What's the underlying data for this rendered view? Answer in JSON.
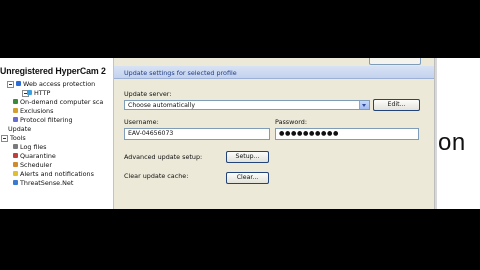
{
  "watermark": "Unregistered HyperCam 2",
  "tree": {
    "items": [
      {
        "label": "Web access protection",
        "icon_color": "#2a6bd8"
      },
      {
        "label": "HTTP",
        "icon_color": "#3aa0e0"
      },
      {
        "label": "On-demand computer sca",
        "icon_color": "#3a8a3a"
      },
      {
        "label": "Exclusions",
        "icon_color": "#d0a030"
      },
      {
        "label": "Protocol filtering",
        "icon_color": "#6a6ad0"
      },
      {
        "label": "Update"
      },
      {
        "label": "Tools"
      },
      {
        "label": "Log files",
        "icon_color": "#7a7a7a"
      },
      {
        "label": "Quarantine",
        "icon_color": "#c04040"
      },
      {
        "label": "Scheduler",
        "icon_color": "#d08a30"
      },
      {
        "label": "Alerts and notifications",
        "icon_color": "#e0c030"
      },
      {
        "label": "ThreatSense.Net",
        "icon_color": "#3a7ad0"
      }
    ]
  },
  "panel": {
    "section_title": "Update settings for selected profile",
    "update_server_label": "Update server:",
    "update_server_value": "Choose automatically",
    "edit_button": "Edit...",
    "username_label": "Username:",
    "username_value": "EAV-04656073",
    "password_label": "Password:",
    "password_value": "●●●●●●●●●●",
    "advanced_label": "Advanced update setup:",
    "setup_button": "Setup...",
    "clear_cache_label": "Clear update cache:",
    "clear_button": "Clear..."
  },
  "side_text": "on"
}
